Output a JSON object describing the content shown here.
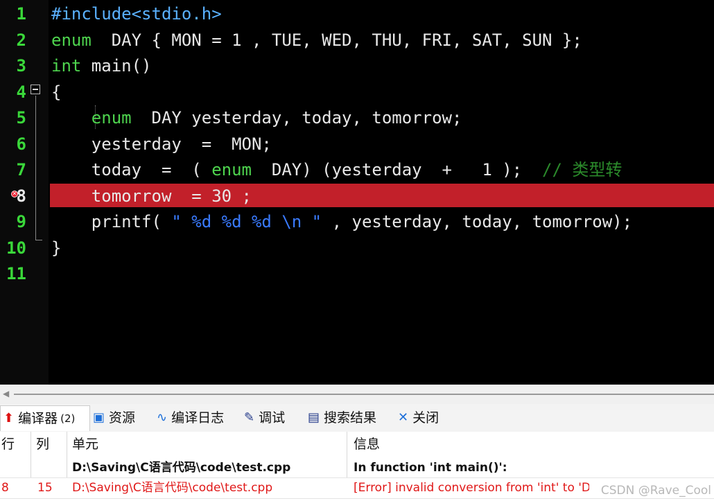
{
  "editor": {
    "line_numbers": [
      "1",
      "2",
      "3",
      "4",
      "5",
      "6",
      "7",
      "8",
      "9",
      "10",
      "11"
    ],
    "lines": [
      [
        {
          "c": "pp",
          "t": "#include<stdio.h>"
        }
      ],
      [
        {
          "c": "kw",
          "t": "enum"
        },
        {
          "c": "txt",
          "t": "  DAY { MON = 1 , TUE, WED, THU, FRI, SAT, SUN };"
        }
      ],
      [
        {
          "c": "kw",
          "t": "int"
        },
        {
          "c": "txt",
          "t": " main()"
        }
      ],
      [
        {
          "c": "txt",
          "t": "{"
        }
      ],
      [
        {
          "c": "txt",
          "t": "    "
        },
        {
          "c": "kw",
          "t": "enum"
        },
        {
          "c": "txt",
          "t": "  DAY yesterday, today, tomorrow;"
        }
      ],
      [
        {
          "c": "txt",
          "t": "    yesterday  =  MON;"
        }
      ],
      [
        {
          "c": "txt",
          "t": "    today  =  ( "
        },
        {
          "c": "kw",
          "t": "enum"
        },
        {
          "c": "txt",
          "t": "  DAY) (yesterday  +   1 );  "
        },
        {
          "c": "cm",
          "t": "// 类型转"
        }
      ],
      [
        {
          "c": "txt",
          "t": "    tomorrow  = 30 ;"
        }
      ],
      [
        {
          "c": "txt",
          "t": "    printf( "
        },
        {
          "c": "str",
          "t": "\" %d %d %d \\n \""
        },
        {
          "c": "txt",
          "t": " , yesterday, today, tomorrow);"
        }
      ],
      [
        {
          "c": "txt",
          "t": "}"
        }
      ],
      []
    ]
  },
  "tabs": [
    {
      "label": "编译器",
      "badge": "(2)",
      "icon": "compiler-icon"
    },
    {
      "label": "资源",
      "icon": "resources-icon"
    },
    {
      "label": "编译日志",
      "icon": "compile-log-icon"
    },
    {
      "label": "调试",
      "icon": "debug-icon"
    },
    {
      "label": "搜索结果",
      "icon": "search-results-icon"
    },
    {
      "label": "关闭",
      "icon": "close-icon"
    }
  ],
  "results": {
    "headers": {
      "line": "行",
      "col": "列",
      "unit": "单元",
      "info": "信息"
    },
    "rows": [
      {
        "line": "",
        "col": "",
        "unit": "D:\\Saving\\C语言代码\\code\\test.cpp",
        "info": "In function 'int main()':",
        "kind": "bold"
      },
      {
        "line": "8",
        "col": "15",
        "unit": "D:\\Saving\\C语言代码\\code\\test.cpp",
        "info": "[Error] invalid conversion from 'int' to 'DAY' [-fpermissive]",
        "kind": "error"
      }
    ],
    "watermark": "CSDN @Rave_Cool"
  },
  "colors": {
    "error_highlight": "#c2202a",
    "line_number": "#3ad83a",
    "keyword": "#4ed44e",
    "string": "#3a7bff",
    "error_text": "#e01818"
  }
}
